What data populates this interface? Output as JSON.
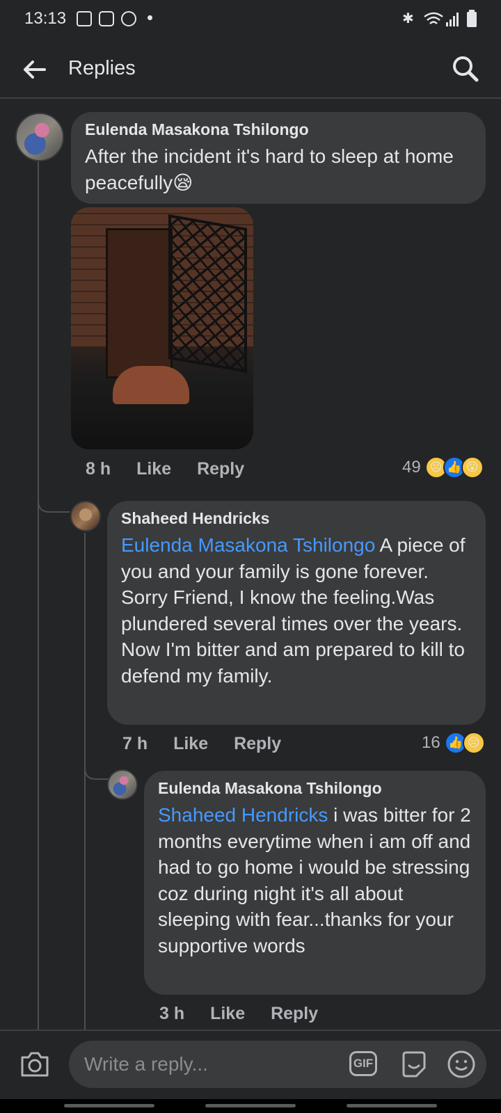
{
  "status_bar": {
    "time": "13:13"
  },
  "header": {
    "title": "Replies"
  },
  "comments": [
    {
      "author": "Eulenda Masakona Tshilongo",
      "text": "After the incident it's hard to sleep at home peacefully",
      "emoji": "😪",
      "time": "8 h",
      "like_label": "Like",
      "reply_label": "Reply",
      "reaction_count": "49"
    },
    {
      "author": "Shaheed Hendricks",
      "mention": "Eulenda Masakona Tshilongo",
      "text": " A piece of you and your family is gone forever. Sorry Friend, I know the feeling.Was plundered several times over the years. Now I'm bitter and am prepared to kill to defend my family.",
      "time": "7 h",
      "like_label": "Like",
      "reply_label": "Reply",
      "reaction_count": "16"
    },
    {
      "author": "Eulenda Masakona Tshilongo",
      "mention": "Shaheed Hendricks",
      "text": " i was bitter for 2 months everytime when i am off and had to go home i would be stressing coz  during night it's all about sleeping with fear...thanks for your supportive words",
      "time": "3 h",
      "like_label": "Like",
      "reply_label": "Reply"
    }
  ],
  "composer": {
    "placeholder": "Write a reply...",
    "gif_label": "GIF"
  },
  "colors": {
    "background": "#242526",
    "bubble": "#3a3b3c",
    "mention": "#4599ff",
    "meta": "#b0b3b8"
  }
}
